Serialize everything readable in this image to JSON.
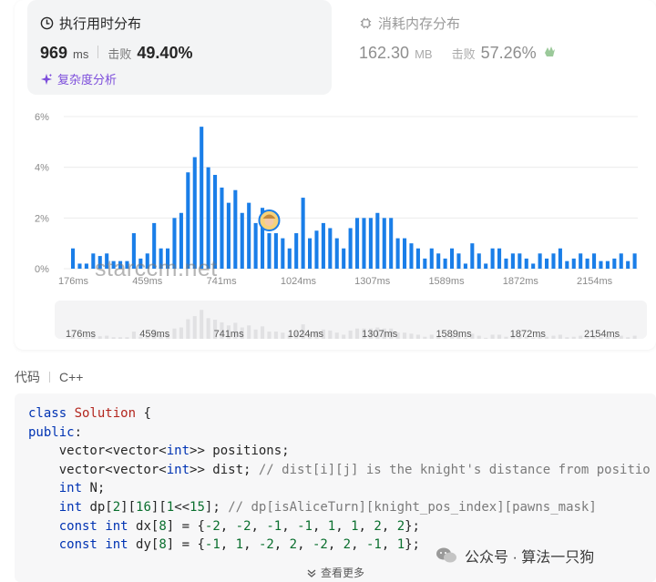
{
  "runtime": {
    "title": "执行用时分布",
    "value": "969",
    "unit": "ms",
    "beat_label": "击败",
    "beat_value": "49.40%",
    "complexity_link": "复杂度分析"
  },
  "memory": {
    "title": "消耗内存分布",
    "value": "162.30",
    "unit": "MB",
    "beat_label": "击败",
    "beat_value": "57.26%"
  },
  "chart_data": {
    "type": "bar",
    "y_ticks": [
      "6%",
      "4%",
      "2%",
      "0%"
    ],
    "x_ticks": [
      "176ms",
      "459ms",
      "741ms",
      "1024ms",
      "1307ms",
      "1589ms",
      "1872ms",
      "2154ms"
    ],
    "ylim": [
      0,
      6
    ],
    "values": [
      0.8,
      0.2,
      0.2,
      0.6,
      0.5,
      0.6,
      0.3,
      0.3,
      0.3,
      1.4,
      0.4,
      0.6,
      1.8,
      0.8,
      0.8,
      2.0,
      2.2,
      3.8,
      4.4,
      5.6,
      4.0,
      3.7,
      3.2,
      2.6,
      3.1,
      2.2,
      2.6,
      1.8,
      2.4,
      1.4,
      1.4,
      1.2,
      0.8,
      1.4,
      2.8,
      1.2,
      1.5,
      1.8,
      1.6,
      1.2,
      0.8,
      1.6,
      2.0,
      2.0,
      2.0,
      2.2,
      2.0,
      2.0,
      1.2,
      1.2,
      1.0,
      0.8,
      0.4,
      0.8,
      0.6,
      0.4,
      0.8,
      0.6,
      0.2,
      1.0,
      0.6,
      0.2,
      0.8,
      0.8,
      0.4,
      0.6,
      0.6,
      0.4,
      0.2,
      0.6,
      0.4,
      0.6,
      0.8,
      0.3,
      0.4,
      0.6,
      0.4,
      0.6,
      0.3,
      0.3,
      0.4,
      0.6,
      0.3,
      0.6
    ],
    "highlight_index": 29,
    "bar_color": "#1a7ee8",
    "grid": true
  },
  "code": {
    "label": "代码",
    "language": "C++",
    "lines": [
      [
        [
          "kw",
          "class"
        ],
        [
          "fn",
          " "
        ],
        [
          "cl",
          "Solution"
        ],
        [
          "fn",
          " {"
        ]
      ],
      [
        [
          "kw",
          "public"
        ],
        [
          "fn",
          ":"
        ]
      ],
      [
        [
          "fn",
          "    vector<vector<"
        ],
        [
          "kw",
          "int"
        ],
        [
          "fn",
          ">> positions;"
        ]
      ],
      [
        [
          "fn",
          "    vector<vector<"
        ],
        [
          "kw",
          "int"
        ],
        [
          "fn",
          ">> dist; "
        ],
        [
          "cm",
          "// dist[i][j] is the knight's distance from positio"
        ]
      ],
      [
        [
          "fn",
          "    "
        ],
        [
          "kw",
          "int"
        ],
        [
          "fn",
          " N;"
        ]
      ],
      [
        [
          "fn",
          "    "
        ],
        [
          "kw",
          "int"
        ],
        [
          "fn",
          " dp["
        ],
        [
          "nm",
          "2"
        ],
        [
          "fn",
          "]["
        ],
        [
          "nm",
          "16"
        ],
        [
          "fn",
          "]["
        ],
        [
          "nm",
          "1"
        ],
        [
          "fn",
          "<<"
        ],
        [
          "nm",
          "15"
        ],
        [
          "fn",
          "]; "
        ],
        [
          "cm",
          "// dp[isAliceTurn][knight_pos_index][pawns_mask]"
        ]
      ],
      [
        [
          "fn",
          "    "
        ],
        [
          "kw",
          "const"
        ],
        [
          "fn",
          " "
        ],
        [
          "kw",
          "int"
        ],
        [
          "fn",
          " dx["
        ],
        [
          "nm",
          "8"
        ],
        [
          "fn",
          "] = {"
        ],
        [
          "nm",
          "-2"
        ],
        [
          "fn",
          ", "
        ],
        [
          "nm",
          "-2"
        ],
        [
          "fn",
          ", "
        ],
        [
          "nm",
          "-1"
        ],
        [
          "fn",
          ", "
        ],
        [
          "nm",
          "-1"
        ],
        [
          "fn",
          ", "
        ],
        [
          "nm",
          "1"
        ],
        [
          "fn",
          ", "
        ],
        [
          "nm",
          "1"
        ],
        [
          "fn",
          ", "
        ],
        [
          "nm",
          "2"
        ],
        [
          "fn",
          ", "
        ],
        [
          "nm",
          "2"
        ],
        [
          "fn",
          "};"
        ]
      ],
      [
        [
          "fn",
          "    "
        ],
        [
          "kw",
          "const"
        ],
        [
          "fn",
          " "
        ],
        [
          "kw",
          "int"
        ],
        [
          "fn",
          " dy["
        ],
        [
          "nm",
          "8"
        ],
        [
          "fn",
          "] = {"
        ],
        [
          "nm",
          "-1"
        ],
        [
          "fn",
          ", "
        ],
        [
          "nm",
          "1"
        ],
        [
          "fn",
          ", "
        ],
        [
          "nm",
          "-2"
        ],
        [
          "fn",
          ", "
        ],
        [
          "nm",
          "2"
        ],
        [
          "fn",
          ", "
        ],
        [
          "nm",
          "-2"
        ],
        [
          "fn",
          ", "
        ],
        [
          "nm",
          "2"
        ],
        [
          "fn",
          ", "
        ],
        [
          "nm",
          "-1"
        ],
        [
          "fn",
          ", "
        ],
        [
          "nm",
          "1"
        ],
        [
          "fn",
          "};"
        ]
      ]
    ],
    "show_more": "查看更多"
  },
  "watermarks": {
    "wechat": "公众号 · 算法一只狗",
    "starccm": "starccm.net"
  },
  "icons": {
    "runtime": "clock-icon",
    "memory": "memory-chip-icon",
    "complexity": "sparkle-icon",
    "show_more": "chevron-down-icon"
  }
}
